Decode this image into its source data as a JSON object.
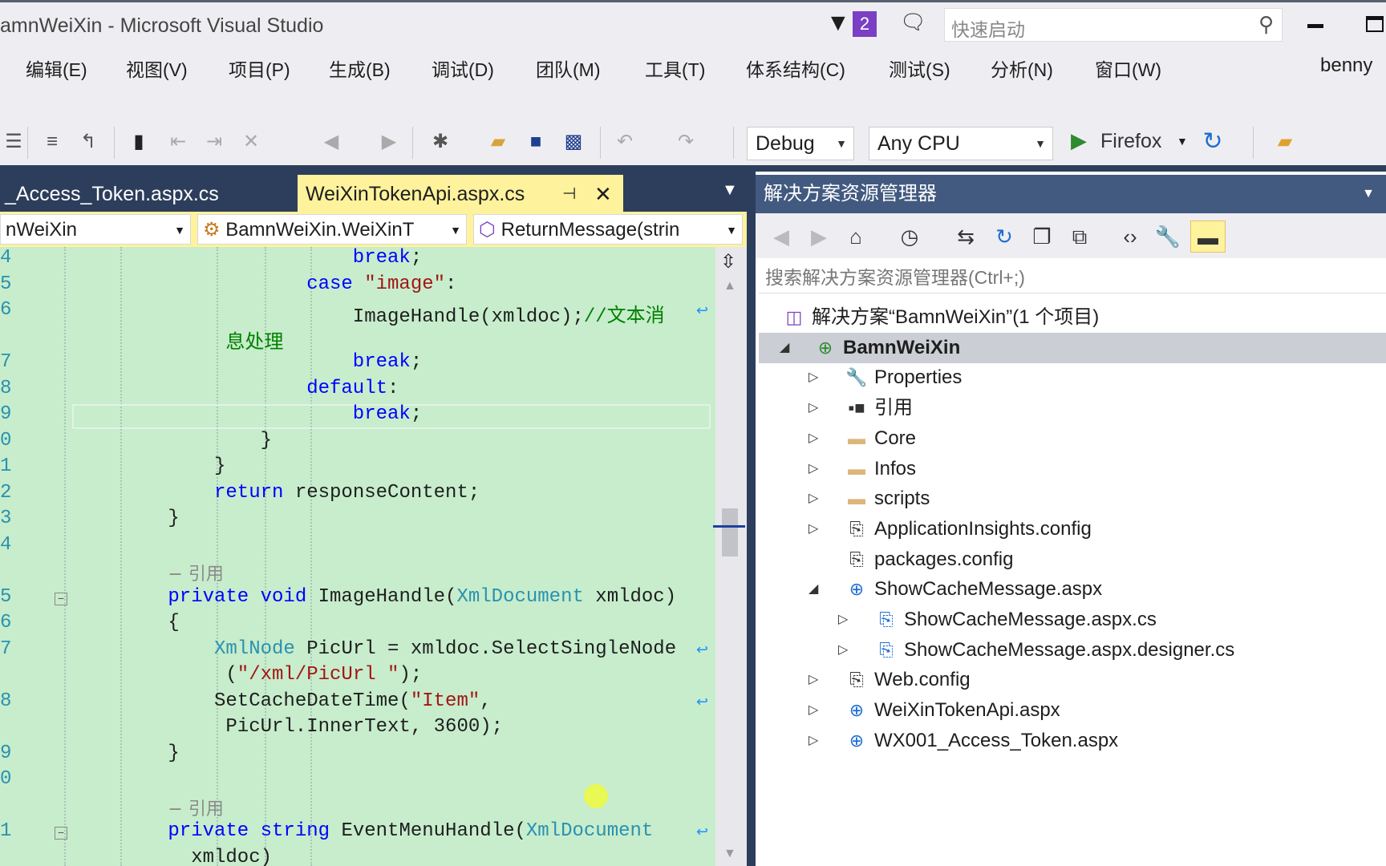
{
  "window": {
    "title": "amnWeiXin - Microsoft Visual Studio",
    "notification_count": "2",
    "quick_launch_placeholder": "快速启动",
    "user": "benny"
  },
  "menu": [
    "编辑(E)",
    "视图(V)",
    "项目(P)",
    "生成(B)",
    "调试(D)",
    "团队(M)",
    "工具(T)",
    "体系结构(C)",
    "测试(S)",
    "分析(N)",
    "窗口(W)"
  ],
  "toolbar": {
    "configuration": "Debug",
    "platform": "Any CPU",
    "run_target": "Firefox"
  },
  "tabs": [
    {
      "label": "_Access_Token.aspx.cs",
      "active": false
    },
    {
      "label": "WeiXinTokenApi.aspx.cs",
      "active": true
    }
  ],
  "nav": {
    "project": "nWeiXin",
    "class": "BamnWeiXin.WeiXinT",
    "member": "ReturnMessage(strin"
  },
  "editor": {
    "background": "#c7edcc",
    "lines": [
      {
        "n": "4",
        "indent": 17,
        "parts": [
          [
            "kw",
            "break"
          ],
          [
            "",
            "; "
          ]
        ]
      },
      {
        "n": "5",
        "indent": 13,
        "parts": [
          [
            "kw",
            "case "
          ],
          [
            "st",
            "\"image\""
          ],
          [
            "",
            ":"
          ]
        ]
      },
      {
        "n": "6",
        "indent": 17,
        "parts": [
          [
            "",
            "ImageHandle(xmldoc);"
          ],
          [
            "cm",
            "//文本消"
          ]
        ],
        "wrap": true
      },
      {
        "n": "",
        "indent": 6,
        "parts": [
          [
            "cm",
            "息处理"
          ]
        ]
      },
      {
        "n": "7",
        "indent": 17,
        "parts": [
          [
            "kw",
            "break"
          ],
          [
            "",
            ";"
          ]
        ]
      },
      {
        "n": "8",
        "indent": 13,
        "parts": [
          [
            "kw",
            "default"
          ],
          [
            "",
            ":"
          ]
        ]
      },
      {
        "n": "9",
        "indent": 17,
        "parts": [
          [
            "kw",
            "break"
          ],
          [
            "",
            ";"
          ]
        ],
        "current": true
      },
      {
        "n": "0",
        "indent": 9,
        "parts": [
          [
            "",
            "}"
          ]
        ]
      },
      {
        "n": "1",
        "indent": 5,
        "parts": [
          [
            "",
            "}"
          ]
        ]
      },
      {
        "n": "2",
        "indent": 5,
        "parts": [
          [
            "kw",
            "return"
          ],
          [
            "",
            " responseContent;"
          ]
        ]
      },
      {
        "n": "3",
        "indent": 1,
        "parts": [
          [
            "",
            "}"
          ]
        ]
      },
      {
        "n": "4",
        "indent": 0,
        "parts": []
      },
      {
        "n": "",
        "indent": 1,
        "parts": [
          [
            "rf",
            "− 引用"
          ]
        ]
      },
      {
        "n": "5",
        "indent": 1,
        "parts": [
          [
            "kw",
            "private void "
          ],
          [
            "",
            "ImageHandle("
          ],
          [
            "ty",
            "XmlDocument"
          ],
          [
            "",
            " xmldoc)"
          ]
        ],
        "fold": true
      },
      {
        "n": "6",
        "indent": 1,
        "parts": [
          [
            "",
            "{"
          ]
        ]
      },
      {
        "n": "7",
        "indent": 5,
        "parts": [
          [
            "ty",
            "XmlNode"
          ],
          [
            "",
            " PicUrl = xmldoc.SelectSingleNode"
          ]
        ],
        "wrap": true
      },
      {
        "n": "",
        "indent": 6,
        "parts": [
          [
            "",
            "("
          ],
          [
            "st",
            "\"/xml/PicUrl \""
          ],
          [
            "",
            ");"
          ]
        ]
      },
      {
        "n": "8",
        "indent": 5,
        "parts": [
          [
            "",
            "SetCacheDateTime("
          ],
          [
            "st",
            "\"Item\""
          ],
          [
            "",
            ","
          ]
        ],
        "wrap": true
      },
      {
        "n": "",
        "indent": 6,
        "parts": [
          [
            "",
            "PicUrl.InnerText, 3600);"
          ]
        ]
      },
      {
        "n": "9",
        "indent": 1,
        "parts": [
          [
            "",
            "}"
          ]
        ]
      },
      {
        "n": "0",
        "indent": 0,
        "parts": []
      },
      {
        "n": "",
        "indent": 1,
        "parts": [
          [
            "rf",
            "− 引用"
          ]
        ]
      },
      {
        "n": "1",
        "indent": 1,
        "parts": [
          [
            "kw",
            "private string "
          ],
          [
            "",
            "EventMenuHandle("
          ],
          [
            "ty",
            "XmlDocument"
          ]
        ],
        "wrap": true,
        "fold": true
      },
      {
        "n": "",
        "indent": 3,
        "parts": [
          [
            "",
            "xmldoc)"
          ]
        ]
      }
    ]
  },
  "solution_explorer": {
    "title": "解决方案资源管理器",
    "search_placeholder": "搜索解决方案资源管理器(Ctrl+;)",
    "tree": [
      {
        "label": "解决方案“BamnWeiXin”(1 个项目)",
        "level": 0,
        "icon": "solution-icon",
        "expander": "none"
      },
      {
        "label": "BamnWeiXin",
        "level": 1,
        "icon": "web-project-icon",
        "expander": "expanded",
        "selected": true
      },
      {
        "label": "Properties",
        "level": 2,
        "icon": "wrench-icon",
        "expander": "collapsed"
      },
      {
        "label": "引用",
        "level": 2,
        "icon": "references-icon",
        "expander": "collapsed"
      },
      {
        "label": "Core",
        "level": 2,
        "icon": "folder-icon",
        "expander": "collapsed"
      },
      {
        "label": "Infos",
        "level": 2,
        "icon": "folder-icon",
        "expander": "collapsed"
      },
      {
        "label": "scripts",
        "level": 2,
        "icon": "folder-icon",
        "expander": "collapsed"
      },
      {
        "label": "ApplicationInsights.config",
        "level": 2,
        "icon": "config-file-icon",
        "expander": "collapsed"
      },
      {
        "label": "packages.config",
        "level": 2,
        "icon": "config-file-icon",
        "expander": "none"
      },
      {
        "label": "ShowCacheMessage.aspx",
        "level": 2,
        "icon": "aspx-file-icon",
        "expander": "expanded"
      },
      {
        "label": "ShowCacheMessage.aspx.cs",
        "level": 3,
        "icon": "cs-file-icon",
        "expander": "collapsed"
      },
      {
        "label": "ShowCacheMessage.aspx.designer.cs",
        "level": 3,
        "icon": "cs-file-icon",
        "expander": "collapsed"
      },
      {
        "label": "Web.config",
        "level": 2,
        "icon": "config-file-icon",
        "expander": "collapsed"
      },
      {
        "label": "WeiXinTokenApi.aspx",
        "level": 2,
        "icon": "aspx-file-icon",
        "expander": "collapsed"
      },
      {
        "label": "WX001_Access_Token.aspx",
        "level": 2,
        "icon": "aspx-file-icon",
        "expander": "collapsed"
      }
    ]
  },
  "colors": {
    "keyword": "#0000ff",
    "type": "#2b91af",
    "string": "#a31515",
    "comment": "#008000",
    "active_tab": "#fff29d",
    "tool_header": "#425a80"
  }
}
